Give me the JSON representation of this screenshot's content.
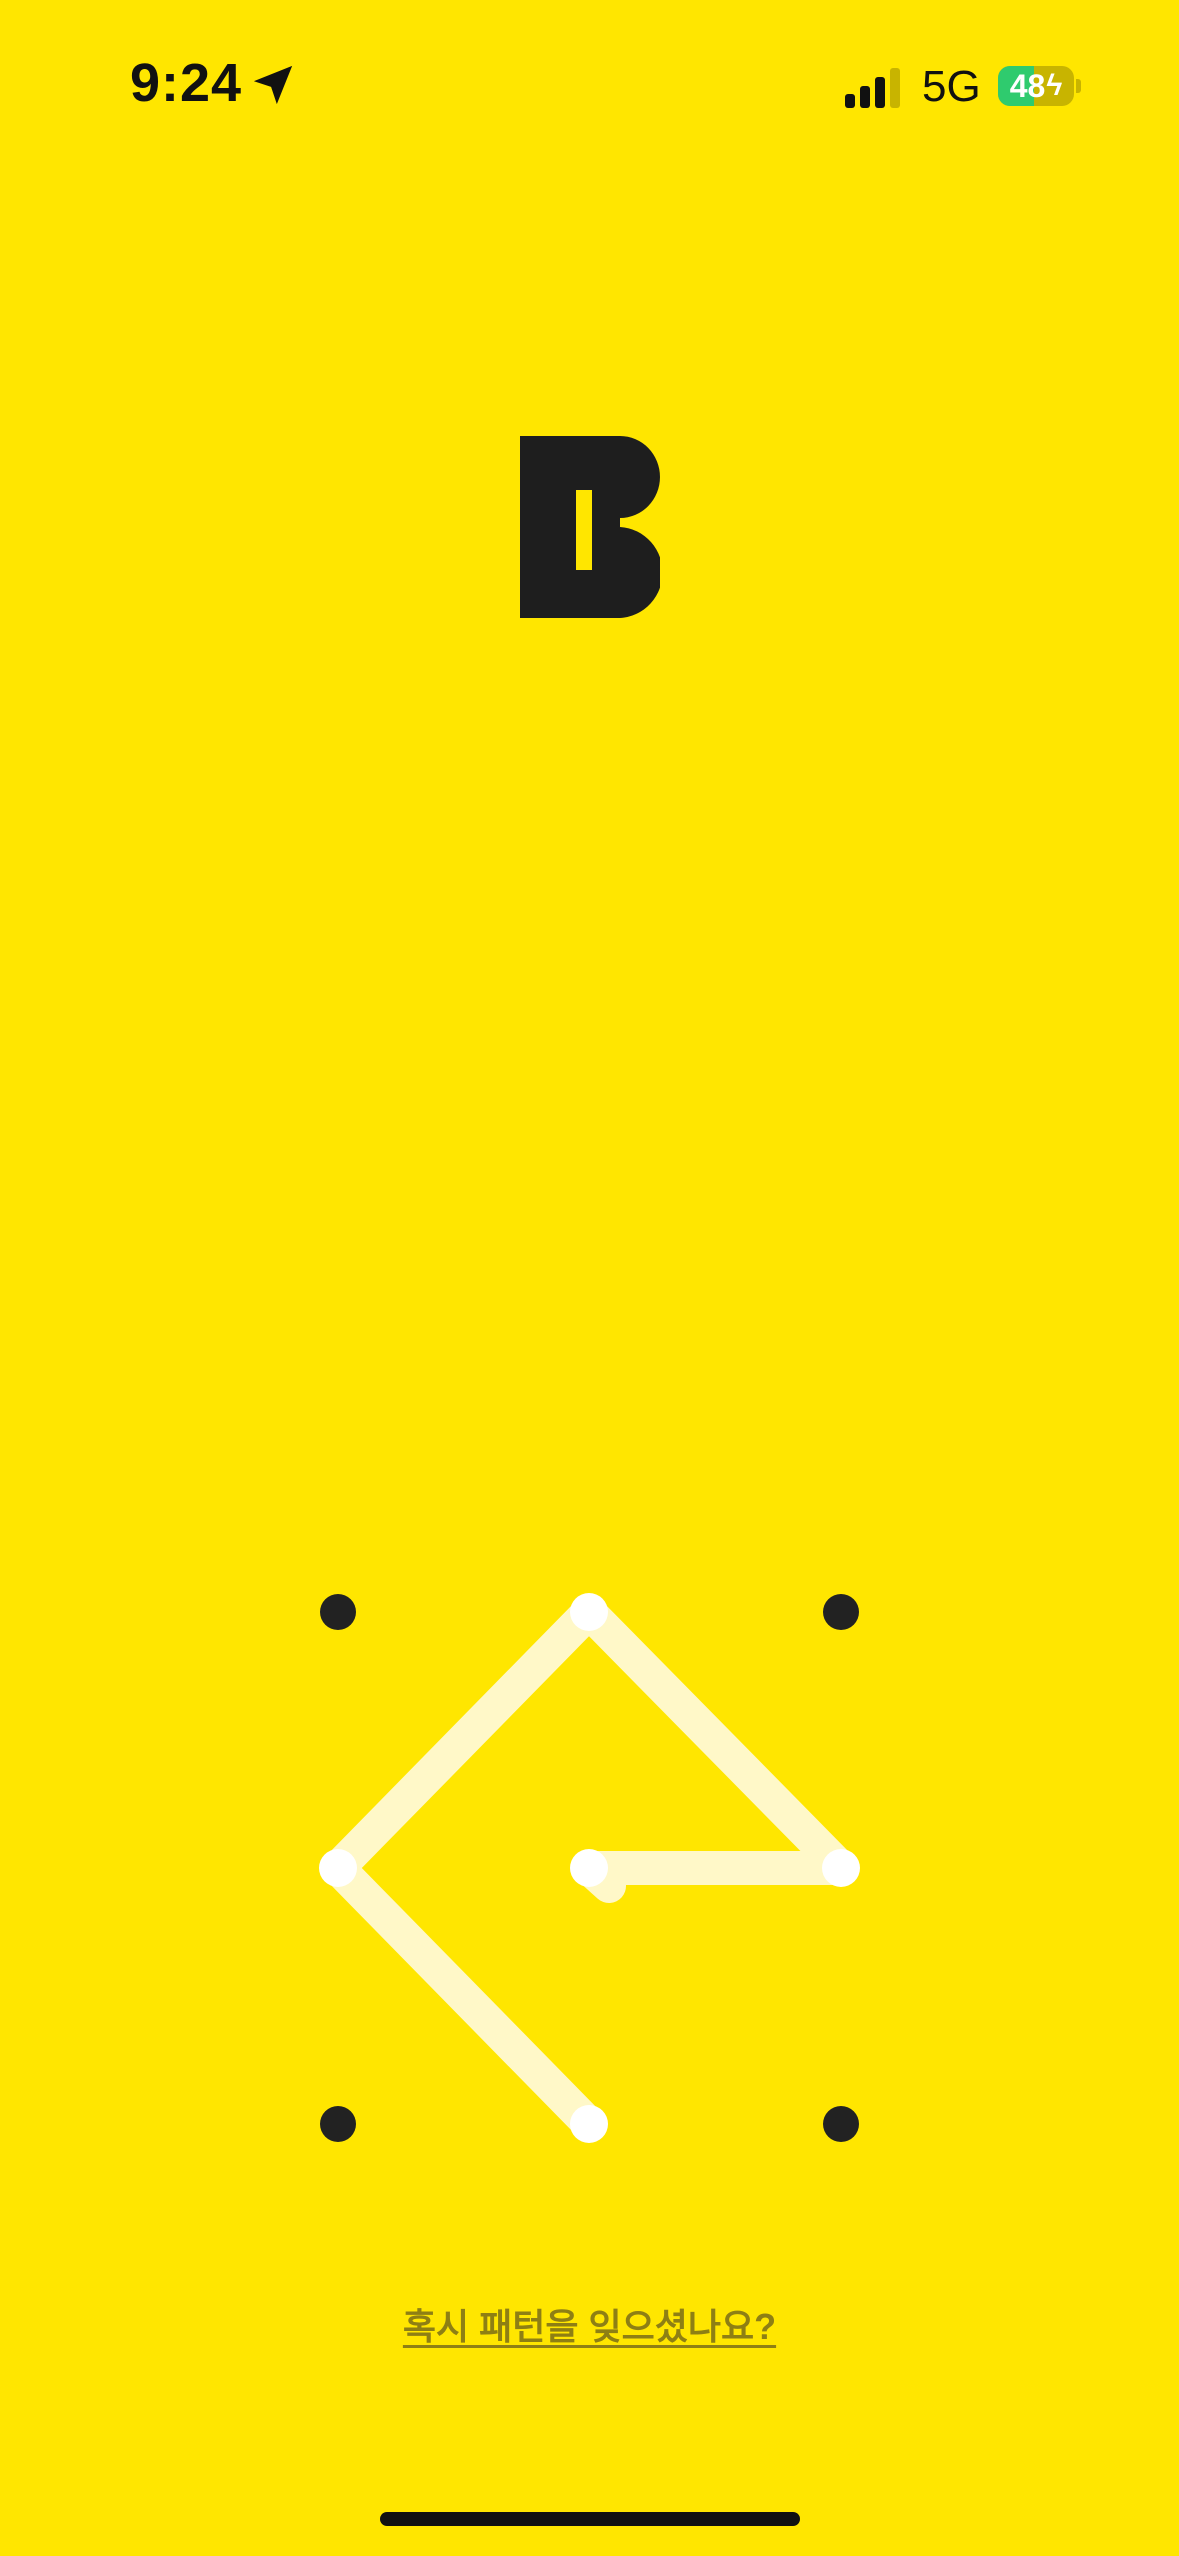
{
  "status_bar": {
    "time": "9:24",
    "network": "5G",
    "battery_level": "48",
    "battery_fraction": 0.48,
    "signal_bars_active": 3,
    "signal_bars_total": 4
  },
  "logo": {
    "icon": "bank-b-logo"
  },
  "pattern_lock": {
    "grid_size": 3,
    "path": [
      [
        1,
        2
      ],
      [
        0,
        1
      ],
      [
        1,
        0
      ],
      [
        2,
        1
      ],
      [
        1,
        1
      ]
    ],
    "colors": {
      "dot": "#222222",
      "active_dot": "#FFFFFF",
      "line": "#FFF8C8"
    }
  },
  "forgot_pattern": {
    "label": "혹시 패턴을 잊으셨나요?"
  },
  "colors": {
    "background": "#FFE600",
    "link": "#8E7F14",
    "battery_fill": "#2FCB6E"
  }
}
